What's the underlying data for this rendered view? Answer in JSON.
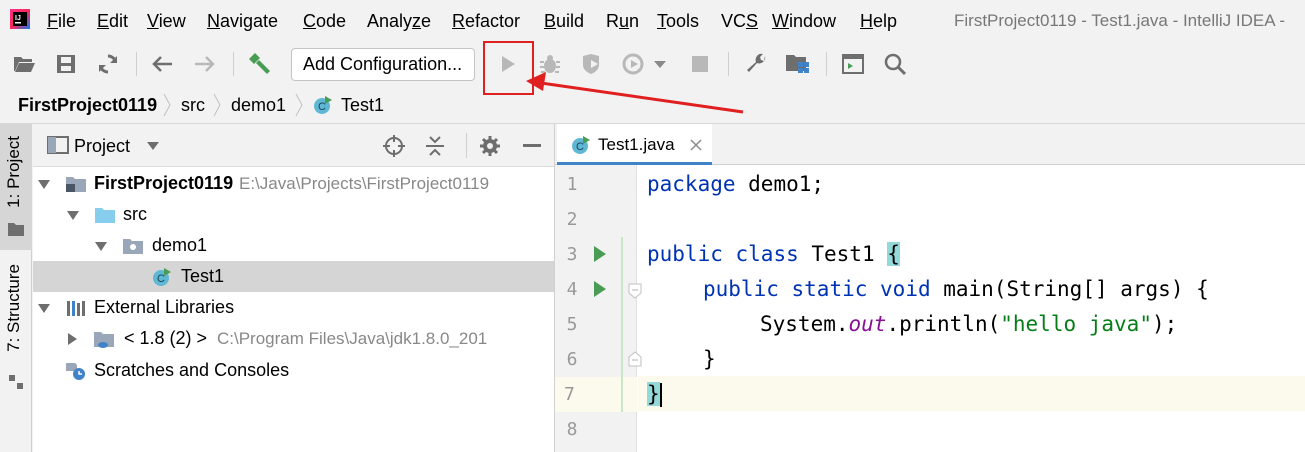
{
  "menubar": {
    "items": [
      {
        "pre": "",
        "u": "F",
        "post": "ile"
      },
      {
        "pre": "",
        "u": "E",
        "post": "dit"
      },
      {
        "pre": "",
        "u": "V",
        "post": "iew"
      },
      {
        "pre": "",
        "u": "N",
        "post": "avigate"
      },
      {
        "pre": "",
        "u": "C",
        "post": "ode"
      },
      {
        "pre": "Analy",
        "u": "z",
        "post": "e"
      },
      {
        "pre": "",
        "u": "R",
        "post": "efactor"
      },
      {
        "pre": "",
        "u": "B",
        "post": "uild"
      },
      {
        "pre": "R",
        "u": "u",
        "post": "n"
      },
      {
        "pre": "",
        "u": "T",
        "post": "ools"
      },
      {
        "pre": "VC",
        "u": "S",
        "post": ""
      },
      {
        "pre": "",
        "u": "W",
        "post": "indow"
      },
      {
        "pre": "",
        "u": "H",
        "post": "elp"
      }
    ],
    "window_title": "FirstProject0119 - Test1.java - IntelliJ IDEA -"
  },
  "toolbar": {
    "add_config_label": "Add Configuration...",
    "icons": [
      "open-folder-icon",
      "save-icon",
      "sync-icon",
      "back-arrow-icon",
      "forward-arrow-icon",
      "build-hammer-icon",
      "run-icon",
      "debug-icon",
      "coverage-icon",
      "profile-icon",
      "dropdown-icon",
      "stop-icon",
      "settings-wrench-icon",
      "project-structure-icon",
      "terminal-icon",
      "search-icon"
    ]
  },
  "breadcrumb": {
    "items": [
      "FirstProject0119",
      "src",
      "demo1",
      "Test1"
    ]
  },
  "side_tabs": {
    "project_label": "1: Project",
    "structure_label": "7: Structure"
  },
  "project_panel": {
    "title": "Project",
    "tree": [
      {
        "label": "FirstProject0119",
        "path": "E:\\Java\\Projects\\FirstProject0119",
        "bold": true
      },
      {
        "label": "src",
        "path": ""
      },
      {
        "label": "demo1",
        "path": ""
      },
      {
        "label": "Test1",
        "path": ""
      },
      {
        "label": "External Libraries",
        "path": ""
      },
      {
        "label": "< 1.8 (2) >",
        "path": "C:\\Program Files\\Java\\jdk1.8.0_201"
      },
      {
        "label": "Scratches and Consoles",
        "path": ""
      }
    ]
  },
  "editor": {
    "tab_label": "Test1.java",
    "line_numbers": [
      "1",
      "2",
      "3",
      "4",
      "5",
      "6",
      "7",
      "8"
    ],
    "code": {
      "l1_kw": "package",
      "l1_rest": " demo1;",
      "l3_kw1": "public",
      "l3_kw2": "class",
      "l3_name": " Test1 ",
      "l3_brace": "{",
      "l4_kw1": "public",
      "l4_kw2": "static",
      "l4_kw3": "void",
      "l4_rest": " main(String[] args) {",
      "l5_a": "System.",
      "l5_field": "out",
      "l5_b": ".println(",
      "l5_str": "\"hello java\"",
      "l5_c": ");",
      "l6": "}",
      "l7_brace": "}"
    }
  },
  "colors": {
    "keyword": "#0033b3",
    "string": "#067d17",
    "annotation_red": "#e02020",
    "run_green": "#499c54"
  }
}
